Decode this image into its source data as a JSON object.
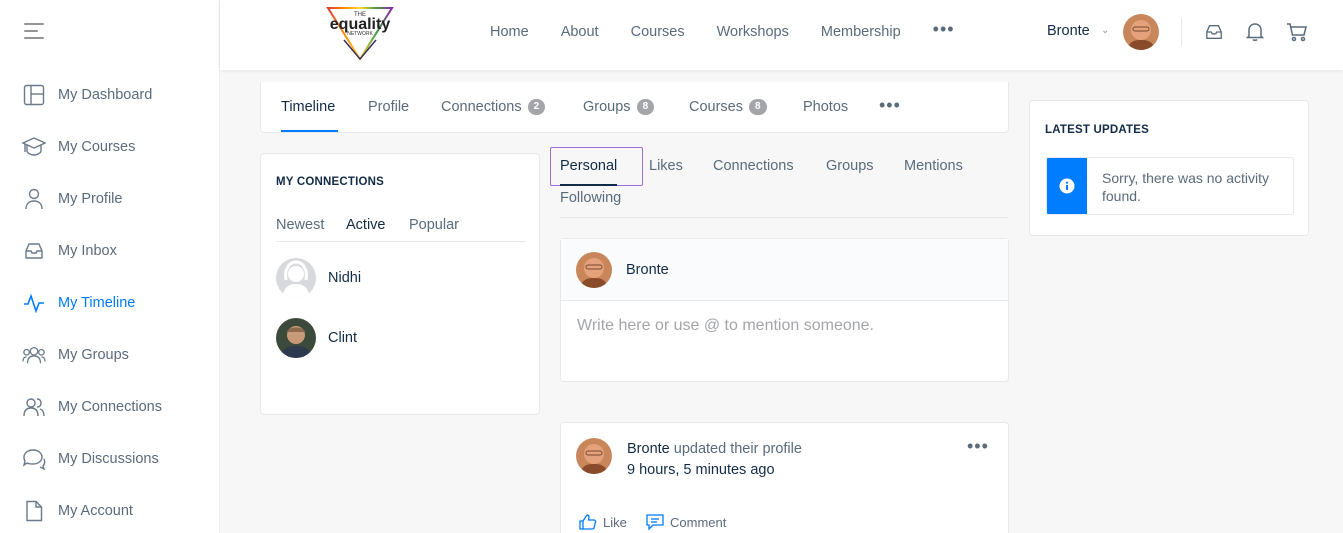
{
  "sidebar": {
    "items": [
      {
        "label": "My Dashboard",
        "icon": "dashboard-icon"
      },
      {
        "label": "My Courses",
        "icon": "graduation-cap-icon"
      },
      {
        "label": "My Profile",
        "icon": "user-icon"
      },
      {
        "label": "My Inbox",
        "icon": "inbox-icon"
      },
      {
        "label": "My Timeline",
        "icon": "pulse-icon",
        "active": true
      },
      {
        "label": "My Groups",
        "icon": "groups-icon"
      },
      {
        "label": "My Connections",
        "icon": "connections-icon"
      },
      {
        "label": "My Discussions",
        "icon": "discussions-icon"
      },
      {
        "label": "My Account",
        "icon": "document-icon"
      }
    ]
  },
  "header": {
    "logo": {
      "line1": "THE",
      "line2": "equality",
      "line3": "NETWORK"
    },
    "nav": [
      "Home",
      "About",
      "Courses",
      "Workshops",
      "Membership"
    ],
    "more": "•••",
    "user_name": "Bronte",
    "caret": "⌄"
  },
  "profile_tabs": [
    {
      "label": "Timeline",
      "active": true
    },
    {
      "label": "Profile"
    },
    {
      "label": "Connections",
      "count": "2"
    },
    {
      "label": "Groups",
      "count": "8"
    },
    {
      "label": "Courses",
      "count": "8"
    },
    {
      "label": "Photos"
    }
  ],
  "profile_tabs_more": "•••",
  "connections_widget": {
    "title": "MY CONNECTIONS",
    "tabs": [
      "Newest",
      "Active",
      "Popular"
    ],
    "active_tab": "Active",
    "members": [
      {
        "name": "Nidhi"
      },
      {
        "name": "Clint"
      }
    ]
  },
  "activity_tabs": [
    "Personal",
    "Likes",
    "Connections",
    "Groups",
    "Mentions",
    "Following"
  ],
  "post_form": {
    "user": "Bronte",
    "placeholder": "Write here or use @ to mention someone."
  },
  "activity": {
    "who": "Bronte",
    "what": "updated their profile",
    "time": "9 hours, 5 minutes ago",
    "more": "•••",
    "like": "Like",
    "comment": "Comment"
  },
  "latest_updates": {
    "title": "LATEST UPDATES",
    "message": "Sorry, there was no activity found."
  },
  "colors": {
    "accent": "#007cff",
    "text": "#122b46",
    "muted": "#5a6b7b"
  }
}
